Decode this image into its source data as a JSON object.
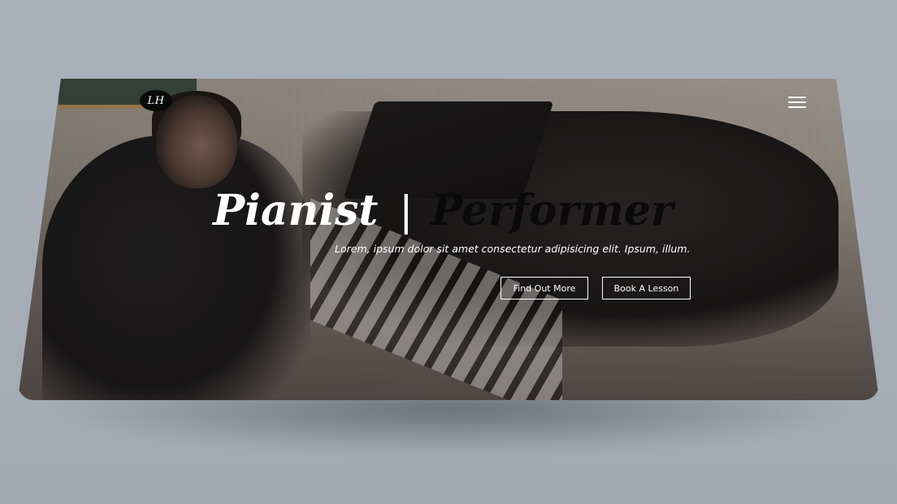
{
  "logo": {
    "text": "LH"
  },
  "hero": {
    "title_left": "Pianist",
    "title_separator": "|",
    "title_right": "Performer",
    "subtitle": "Lorem, ipsum dolor sit amet consectetur adipisicing elit. Ipsum, illum."
  },
  "buttons": {
    "find_out_more": "Find Out More",
    "book_a_lesson": "Book A Lesson"
  },
  "icons": {
    "menu": "hamburger-menu-icon"
  },
  "colors": {
    "page_background": "#a7aeb7",
    "text_light": "#ffffff",
    "text_dark": "#0a0a0a",
    "logo_bg": "#0b0b0b"
  }
}
